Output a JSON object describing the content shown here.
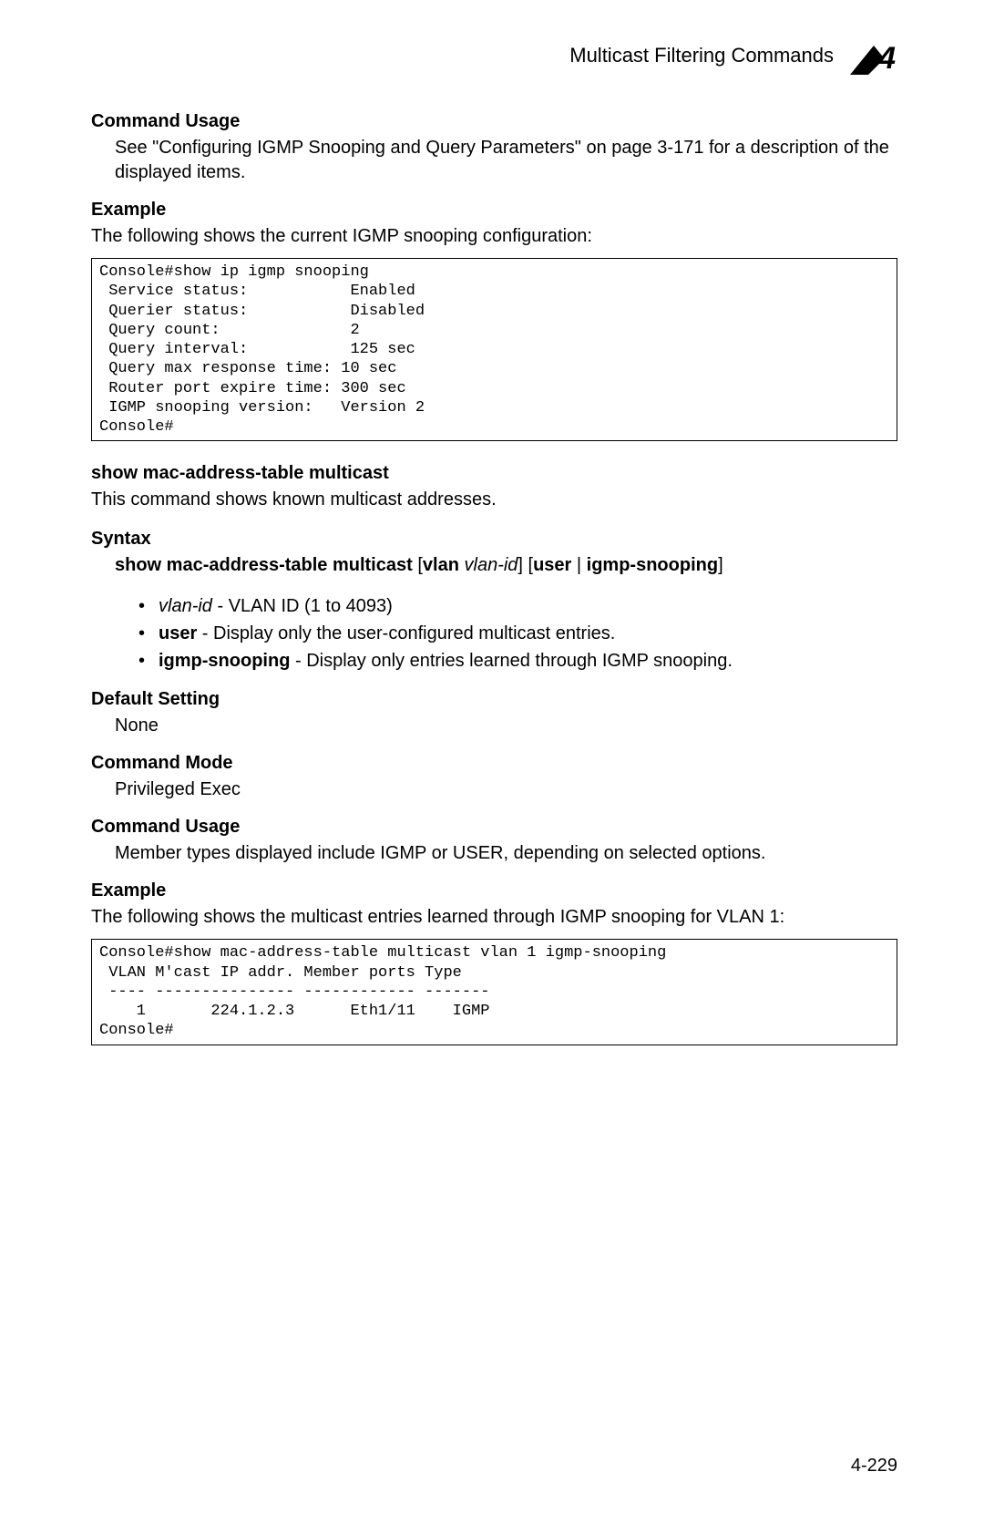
{
  "header": {
    "title": "Multicast Filtering Commands",
    "chapter_number": "4"
  },
  "sec_command_usage1": {
    "heading": "Command Usage",
    "text": "See \"Configuring IGMP Snooping and Query Parameters\" on page 3-171 for a description of the displayed items."
  },
  "sec_example1": {
    "heading": "Example",
    "intro": "The following shows the current IGMP snooping configuration:",
    "code": "Console#show ip igmp snooping\n Service status:           Enabled\n Querier status:           Disabled\n Query count:              2\n Query interval:           125 sec\n Query max response time: 10 sec\n Router port expire time: 300 sec\n IGMP snooping version:   Version 2\nConsole#"
  },
  "sec_title": "show mac-address-table multicast",
  "sec_desc": "This command shows known multicast addresses.",
  "sec_syntax": {
    "heading": "Syntax",
    "cmd_bold1": "show mac-address-table multicast",
    "open_br1": " [",
    "vlan_kw": "vlan",
    "space1": " ",
    "vlan_param": "vlan-id",
    "close_br1": "] [",
    "user_kw": "user",
    "pipe": " | ",
    "igmp_kw": "igmp-snooping",
    "close_br2": "]",
    "params": [
      {
        "italic": "vlan-id",
        "rest": " - VLAN ID (1 to 4093)"
      },
      {
        "boldlead": "user",
        "rest": " - Display only the user-configured multicast entries."
      },
      {
        "boldlead": "igmp-snooping",
        "rest": " - Display only entries learned through IGMP snooping."
      }
    ]
  },
  "sec_default": {
    "heading": "Default Setting",
    "text": "None"
  },
  "sec_mode": {
    "heading": "Command Mode",
    "text": "Privileged Exec"
  },
  "sec_command_usage2": {
    "heading": "Command Usage",
    "text": "Member types displayed include IGMP or USER, depending on selected options."
  },
  "sec_example2": {
    "heading": "Example",
    "intro": "The following shows the multicast entries learned through IGMP snooping for VLAN 1:",
    "code": "Console#show mac-address-table multicast vlan 1 igmp-snooping\n VLAN M'cast IP addr. Member ports Type\n ---- --------------- ------------ -------\n    1       224.1.2.3      Eth1/11    IGMP\nConsole#"
  },
  "page_number": "4-229"
}
